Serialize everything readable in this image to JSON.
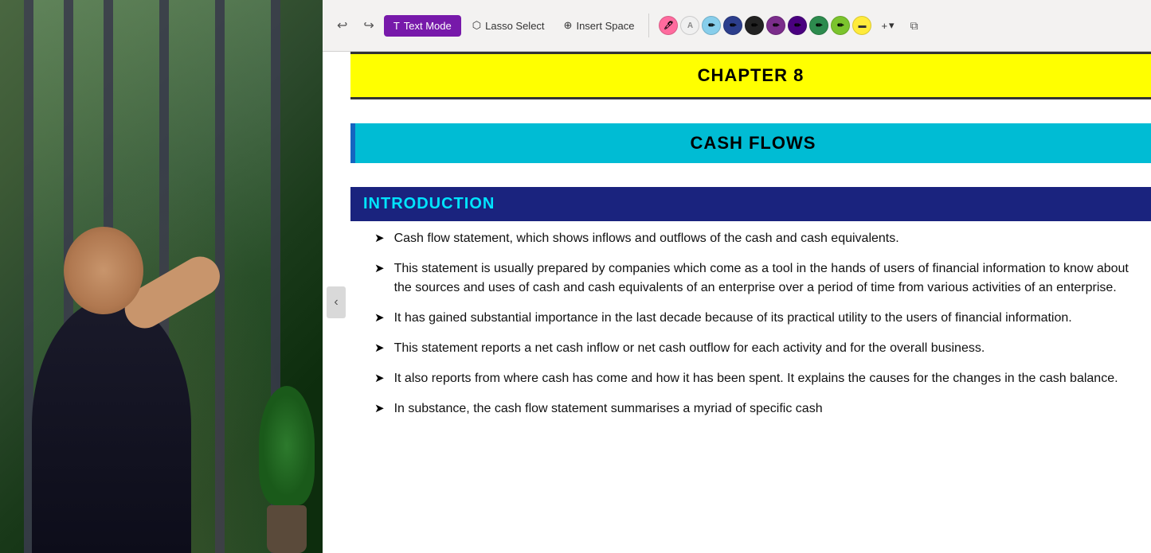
{
  "toolbar": {
    "undo_label": "↩",
    "redo_label": "↪",
    "text_mode_label": "Text Mode",
    "lasso_select_label": "Lasso Select",
    "insert_space_label": "Insert Space",
    "add_label": "+",
    "colors": [
      {
        "name": "pink",
        "hex": "#ff6b9e",
        "icon": "🖊"
      },
      {
        "name": "white-pen",
        "hex": "#f0f0f0",
        "icon": "A"
      },
      {
        "name": "light-blue",
        "hex": "#87ceeb",
        "icon": "✏"
      },
      {
        "name": "dark-blue-pen",
        "hex": "#2c3e8c",
        "icon": "✏"
      },
      {
        "name": "black",
        "hex": "#222222",
        "icon": "✏"
      },
      {
        "name": "purple",
        "hex": "#7b2d8b",
        "icon": "✏"
      },
      {
        "name": "dark-purple",
        "hex": "#4a0080",
        "icon": "✏"
      },
      {
        "name": "green",
        "hex": "#2d8b4e",
        "icon": "✏"
      },
      {
        "name": "lime-green",
        "hex": "#7bc42d",
        "icon": "✏"
      },
      {
        "name": "yellow",
        "hex": "#ffeb3b",
        "icon": "▬"
      }
    ]
  },
  "content": {
    "nav_arrow": "‹",
    "chapter_title": "CHAPTER 8",
    "cash_flows_title": "CASH FLOWS",
    "intro_title": "INTRODUCTION",
    "bullets": [
      {
        "text": "Cash flow statement, which shows inflows and outflows of the cash and cash equivalents."
      },
      {
        "text": "This statement is usually prepared by companies which come as a tool in the hands of users of financial information to know about the sources and uses of cash and cash equivalents of an enterprise over a period of time from various activities of an enterprise."
      },
      {
        "text": "It has gained substantial importance in the last decade because of its practical utility to the users of financial information."
      },
      {
        "text": "This statement reports a net cash inflow or net cash outflow for each activity and for the overall business."
      },
      {
        "text": "It also reports from where cash has come and how it has been spent. It explains the causes for the changes in the cash balance."
      },
      {
        "text": "In substance, the cash flow statement summarises a myriad of specific cash"
      }
    ]
  }
}
